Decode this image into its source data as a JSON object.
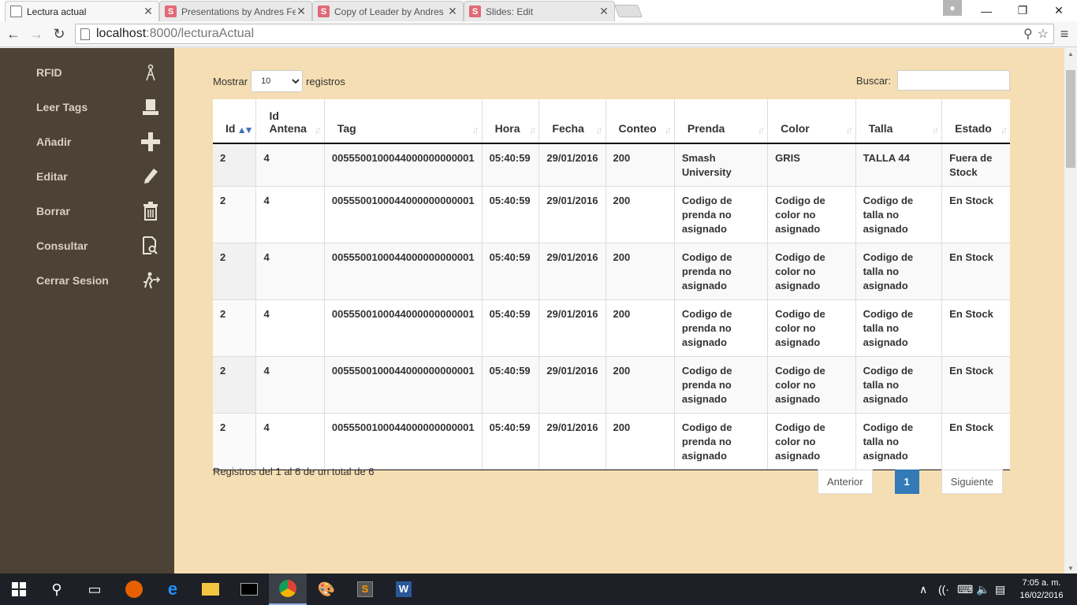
{
  "browser": {
    "tabs": [
      {
        "title": "Lectura actual",
        "favicon": "page"
      },
      {
        "title": "Presentations by Andres Fe",
        "favicon": "S"
      },
      {
        "title": "Copy of Leader by Andres",
        "favicon": "S"
      },
      {
        "title": "Slides: Edit",
        "favicon": "S"
      }
    ],
    "url_host": "localhost",
    "url_path": ":8000/lecturaActual"
  },
  "sidebar": {
    "items": [
      {
        "label": "RFID",
        "icon": "antenna-icon"
      },
      {
        "label": "Leer Tags",
        "icon": "reader-icon"
      },
      {
        "label": "Añadir",
        "icon": "plus-icon"
      },
      {
        "label": "Editar",
        "icon": "pencil-icon"
      },
      {
        "label": "Borrar",
        "icon": "trash-icon"
      },
      {
        "label": "Consultar",
        "icon": "search-document-icon"
      },
      {
        "label": "Cerrar Sesion",
        "icon": "logout-icon"
      }
    ]
  },
  "table_controls": {
    "show_label": "Mostrar",
    "length_value": "10",
    "records_label": "registros",
    "search_label": "Buscar:"
  },
  "table": {
    "columns": [
      "Id",
      "Id Antena",
      "Tag",
      "Hora",
      "Fecha",
      "Conteo",
      "Prenda",
      "Color",
      "Talla",
      "Estado"
    ],
    "rows": [
      [
        "2",
        "4",
        "0055500100044000000000001",
        "05:40:59",
        "29/01/2016",
        "200",
        "Smash University",
        "GRIS",
        "TALLA 44",
        "Fuera de Stock"
      ],
      [
        "2",
        "4",
        "0055500100044000000000001",
        "05:40:59",
        "29/01/2016",
        "200",
        "Codigo de prenda no asignado",
        "Codigo de color no asignado",
        "Codigo de talla no asignado",
        "En Stock"
      ],
      [
        "2",
        "4",
        "0055500100044000000000001",
        "05:40:59",
        "29/01/2016",
        "200",
        "Codigo de prenda no asignado",
        "Codigo de color no asignado",
        "Codigo de talla no asignado",
        "En Stock"
      ],
      [
        "2",
        "4",
        "0055500100044000000000001",
        "05:40:59",
        "29/01/2016",
        "200",
        "Codigo de prenda no asignado",
        "Codigo de color no asignado",
        "Codigo de talla no asignado",
        "En Stock"
      ],
      [
        "2",
        "4",
        "0055500100044000000000001",
        "05:40:59",
        "29/01/2016",
        "200",
        "Codigo de prenda no asignado",
        "Codigo de color no asignado",
        "Codigo de talla no asignado",
        "En Stock"
      ],
      [
        "2",
        "4",
        "0055500100044000000000001",
        "05:40:59",
        "29/01/2016",
        "200",
        "Codigo de prenda no asignado",
        "Codigo de color no asignado",
        "Codigo de talla no asignado",
        "En Stock"
      ]
    ]
  },
  "footer": {
    "info": "Registros del 1 al 6 de un total de 6",
    "prev": "Anterior",
    "page": "1",
    "next": "Siguiente"
  },
  "taskbar": {
    "time": "7:05 a. m.",
    "date": "16/02/2016"
  },
  "colors": {
    "sidebar_bg": "#4c4235",
    "main_bg": "#f5deb3",
    "pager_active": "#337ab7"
  }
}
